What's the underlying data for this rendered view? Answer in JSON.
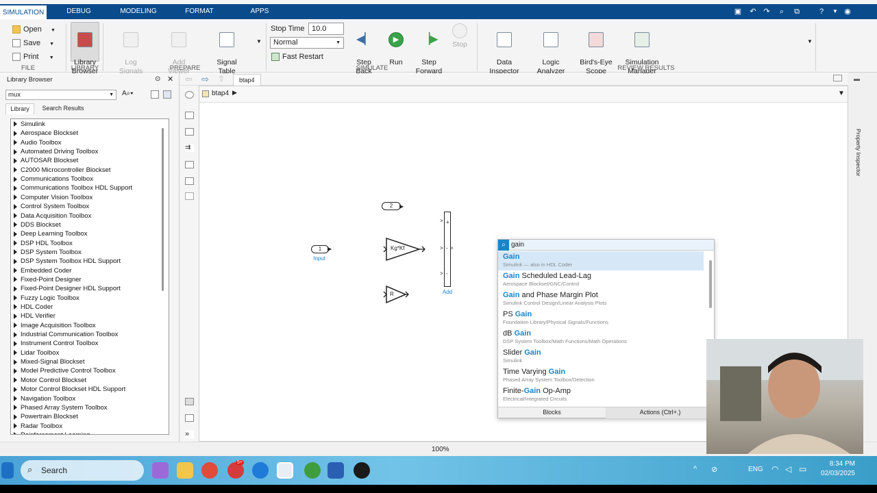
{
  "tabs": [
    "SIMULATION",
    "DEBUG",
    "MODELING",
    "FORMAT",
    "APPS"
  ],
  "ribbon": {
    "file": {
      "open": "Open",
      "save": "Save",
      "print": "Print",
      "group": "FILE"
    },
    "library": {
      "button": "Library\nBrowser",
      "group": "LIBRARY"
    },
    "prepare": {
      "log": "Log\nSignals",
      "add_viewer": "Add\nViewer",
      "signal_table": "Signal\nTable",
      "group": "PREPARE"
    },
    "simulate": {
      "stop_time_label": "Stop Time",
      "stop_time_value": "10.0",
      "mode": "Normal",
      "fast_restart": "Fast Restart",
      "step_back": "Step\nBack",
      "run": "Run",
      "step_forward": "Step\nForward",
      "stop": "Stop",
      "group": "SIMULATE"
    },
    "review": {
      "data_inspector": "Data\nInspector",
      "logic_analyzer": "Logic\nAnalyzer",
      "birds_eye": "Bird's-Eye\nScope",
      "sim_manager": "Simulation\nManager",
      "group": "REVIEW RESULTS"
    }
  },
  "library_browser": {
    "title": "Library Browser",
    "search_value": "mux",
    "tab_library": "Library",
    "tab_search": "Search Results",
    "items": [
      "Simulink",
      "Aerospace Blockset",
      "Audio Toolbox",
      "Automated Driving Toolbox",
      "AUTOSAR Blockset",
      "C2000 Microcontroller Blockset",
      "Communications Toolbox",
      "Communications Toolbox HDL Support",
      "Computer Vision Toolbox",
      "Control System Toolbox",
      "Data Acquisition Toolbox",
      "DDS Blockset",
      "Deep Learning Toolbox",
      "DSP HDL Toolbox",
      "DSP System Toolbox",
      "DSP System Toolbox HDL Support",
      "Embedded Coder",
      "Fixed-Point Designer",
      "Fixed-Point Designer HDL Support",
      "Fuzzy Logic Toolbox",
      "HDL Coder",
      "HDL Verifier",
      "Image Acquisition Toolbox",
      "Industrial Communication Toolbox",
      "Instrument Control Toolbox",
      "Lidar Toolbox",
      "Mixed-Signal Blockset",
      "Model Predictive Control Toolbox",
      "Motor Control Blockset",
      "Motor Control Blockset HDL Support",
      "Navigation Toolbox",
      "Phased Array System Toolbox",
      "Powertrain Blockset",
      "Radar Toolbox",
      "Reinforcement Learning"
    ]
  },
  "model": {
    "tab": "btap4",
    "breadcrumb": "btap4",
    "zoom": "100%",
    "blocks": {
      "input_port": "1",
      "input_label": "Input",
      "port2": "2",
      "gain1": "Kg*Kf",
      "gain2": "R",
      "add_label": "Add",
      "add_signs": [
        "+",
        "-",
        "-"
      ]
    }
  },
  "quick_insert": {
    "query": "gain",
    "results": [
      {
        "pre": "",
        "match": "Gain",
        "post": "",
        "sub": "Simulink — also in HDL Coder"
      },
      {
        "pre": "",
        "match": "Gain",
        "post": " Scheduled Lead-Lag",
        "sub": "Aerospace Blockset/GNC/Control"
      },
      {
        "pre": "",
        "match": "Gain",
        "post": " and Phase Margin Plot",
        "sub": "Simulink Control Design/Linear Analysis Plots"
      },
      {
        "pre": "PS ",
        "match": "Gain",
        "post": "",
        "sub": "Foundation Library/Physical Signals/Functions"
      },
      {
        "pre": "dB ",
        "match": "Gain",
        "post": "",
        "sub": "DSP System Toolbox/Math Functions/Math Operations"
      },
      {
        "pre": "Slider ",
        "match": "Gain",
        "post": "",
        "sub": "Simulink"
      },
      {
        "pre": "Time Varying ",
        "match": "Gain",
        "post": "",
        "sub": "Phased Array System Toolbox/Detection"
      },
      {
        "pre": "Finite-",
        "match": "Gain",
        "post": " Op-Amp",
        "sub": "Electrical/Integrated Circuits"
      }
    ],
    "footer_blocks": "Blocks",
    "footer_actions": "Actions (Ctrl+.)"
  },
  "property_inspector": "Property Inspector",
  "taskbar": {
    "search": "Search",
    "lang": "ENG",
    "time": "8:34 PM",
    "date": "02/03/2025",
    "badge": "5+"
  },
  "colors": {
    "tabbar": "#0a4b8c",
    "accent": "#1a84c8",
    "taskbar": "#4aa3d6"
  }
}
